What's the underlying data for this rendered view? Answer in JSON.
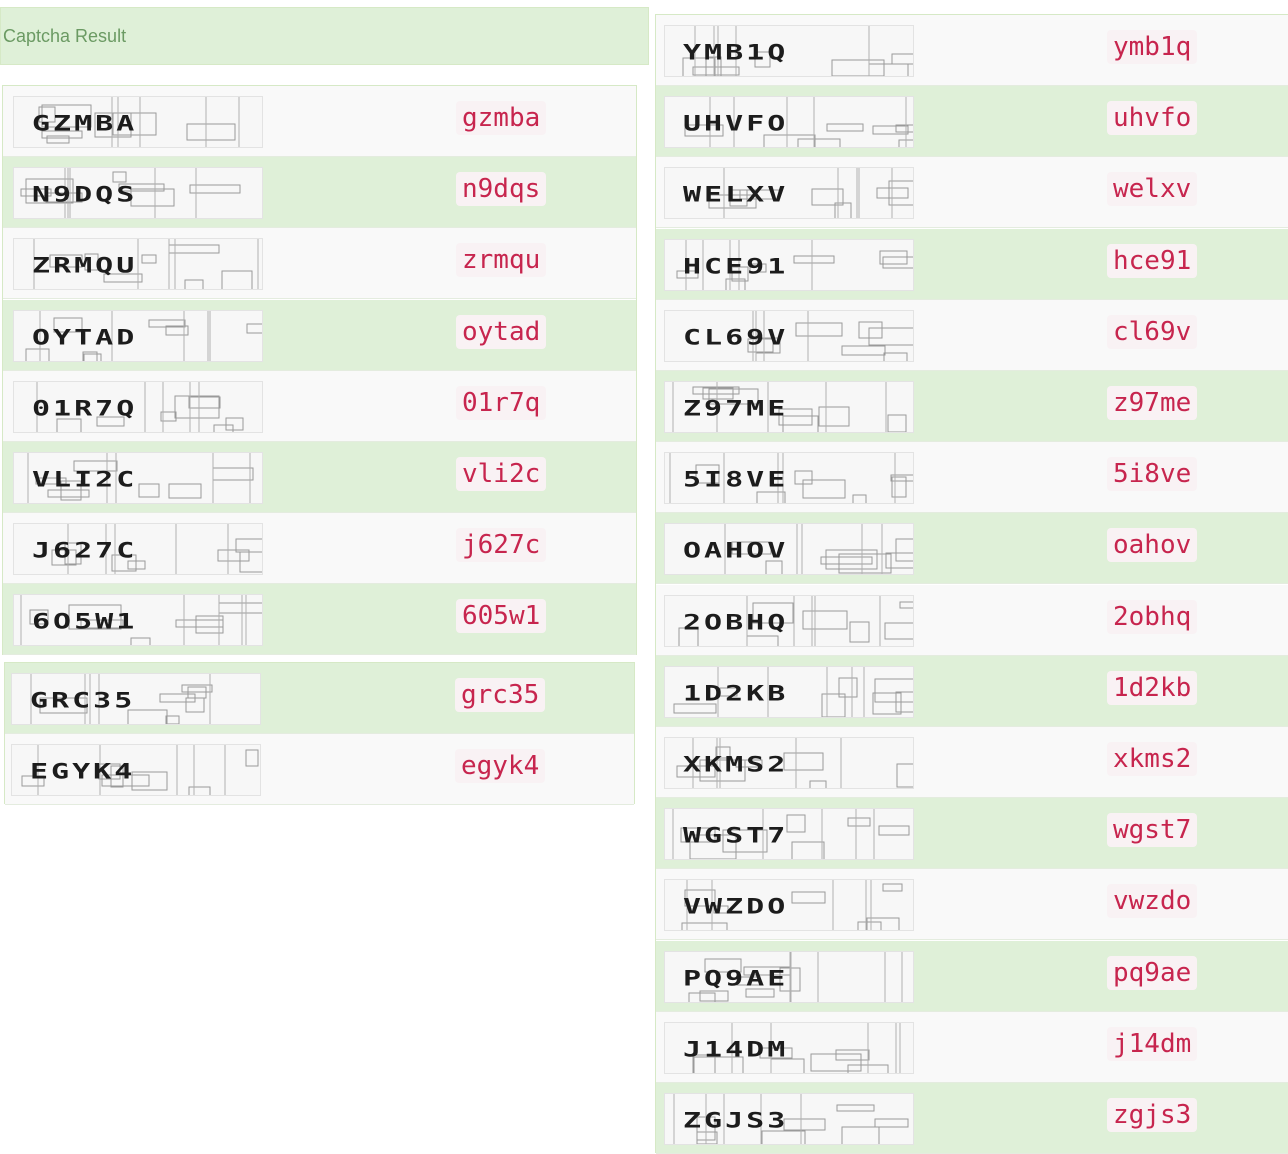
{
  "panel": {
    "title": "Captcha Result"
  },
  "columns": [
    {
      "rows": [
        {
          "image_text": "GZMBA",
          "result": "gzmba"
        },
        {
          "image_text": "N9DQS",
          "result": "n9dqs"
        },
        {
          "image_text": "ZRMQU",
          "result": "zrmqu"
        },
        {
          "image_text": "OYTAD",
          "result": "oytad"
        },
        {
          "image_text": "01R7Q",
          "result": "01r7q"
        },
        {
          "image_text": "VLI2C",
          "result": "vli2c"
        },
        {
          "image_text": "J627C",
          "result": "j627c"
        },
        {
          "image_text": "6O5W1",
          "result": "605w1"
        }
      ]
    },
    {
      "rows": [
        {
          "image_text": "GRC35",
          "result": "grc35"
        },
        {
          "image_text": "EGYK4",
          "result": "egyk4"
        }
      ]
    },
    {
      "rows": [
        {
          "image_text": "YMB1Q",
          "result": "ymb1q"
        },
        {
          "image_text": "UHVFO",
          "result": "uhvfo"
        },
        {
          "image_text": "WELXV",
          "result": "welxv"
        },
        {
          "image_text": "HCE91",
          "result": "hce91"
        },
        {
          "image_text": "CL69V",
          "result": "cl69v"
        },
        {
          "image_text": "Z97ME",
          "result": "z97me"
        },
        {
          "image_text": "5I8VE",
          "result": "5i8ve"
        },
        {
          "image_text": "OAHOV",
          "result": "oahov"
        },
        {
          "image_text": "2OBHQ",
          "result": "2obhq"
        },
        {
          "image_text": "1D2KB",
          "result": "1d2kb"
        },
        {
          "image_text": "XKMS2",
          "result": "xkms2"
        },
        {
          "image_text": "WGST7",
          "result": "wgst7"
        },
        {
          "image_text": "VWZDO",
          "result": "vwzdo"
        },
        {
          "image_text": "PQ9AE",
          "result": "pq9ae"
        },
        {
          "image_text": "J14DM",
          "result": "j14dm"
        },
        {
          "image_text": "ZGJS3",
          "result": "zgjs3"
        }
      ]
    }
  ],
  "colors": {
    "header_bg": "#dff0d8",
    "header_text": "#6b9a63",
    "row_odd": "#f9f9f9",
    "row_even": "#dff0d8",
    "code_text": "#c7254e",
    "code_bg": "#f9f2f4"
  }
}
